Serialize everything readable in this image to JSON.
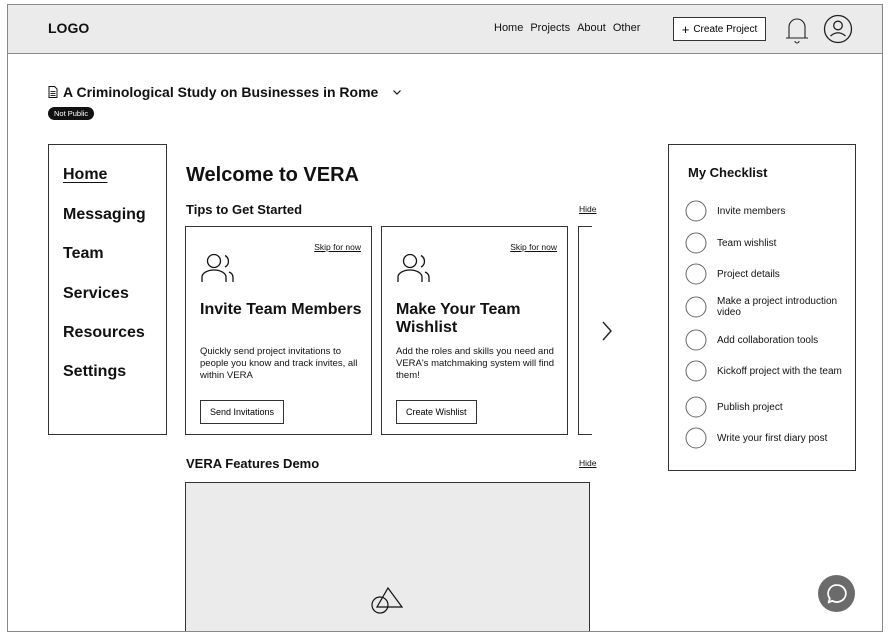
{
  "header": {
    "logo": "LOGO",
    "nav": [
      "Home",
      "Projects",
      "About",
      "Other"
    ],
    "create_project": "Create Project"
  },
  "project": {
    "title": "A Criminological Study on Businesses in Rome",
    "visibility": "Not Public"
  },
  "sidebar": {
    "items": [
      "Home",
      "Messaging",
      "Team",
      "Services",
      "Resources",
      "Settings"
    ],
    "active": "Home"
  },
  "main": {
    "welcome": "Welcome to VERA",
    "tips": {
      "title": "Tips to Get Started",
      "hide": "Hide",
      "cards": [
        {
          "skip": "Skip for now",
          "title": "Invite Team Members",
          "text": "Quickly send project invitations to people you know and track invites, all within VERA",
          "button": "Send Invitations"
        },
        {
          "skip": "Skip for now",
          "title": "Make Your Team Wishlist",
          "text": "Add the roles and skills you need and VERA's matchmaking system will find them!",
          "button": "Create Wishlist"
        }
      ]
    },
    "demo": {
      "title": "VERA Features Demo",
      "hide": "Hide"
    }
  },
  "checklist": {
    "title": "My Checklist",
    "items": [
      "Invite members",
      "Team wishlist",
      "Project details",
      "Make a project introduction video",
      "Add collaboration tools",
      "Kickoff project with the team",
      "Publish project",
      "Write your first diary post"
    ]
  },
  "icons": {
    "document": "document-icon",
    "dropdown": "chevron-down-icon",
    "bell": "bell-icon",
    "profile": "user-circle-icon",
    "team": "people-icon",
    "next": "chevron-right-icon",
    "media": "shapes-icon",
    "chat": "chat-bubble-icon",
    "check": "circle-checkbox-icon"
  }
}
